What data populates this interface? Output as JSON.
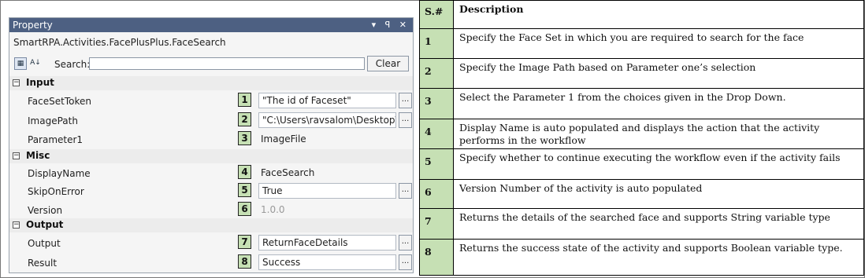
{
  "panel": {
    "title": "Property",
    "controls": "▾ ꟼ ✕",
    "subtitle": "SmartRPA.Activities.FacePlusPlus.FaceSearch",
    "search_label": "Search:",
    "search_value": "",
    "clear_label": "Clear",
    "categories": [
      {
        "name": "Input"
      },
      {
        "name": "Misc"
      },
      {
        "name": "Output"
      }
    ],
    "properties": [
      {
        "name": "FaceSetToken",
        "num": "1",
        "value": "\"The id of Faceset\""
      },
      {
        "name": "ImagePath",
        "num": "2",
        "value": "\"C:\\Users\\ravsalom\\Desktop\\ele"
      },
      {
        "name": "Parameter1",
        "num": "3",
        "value": "ImageFile"
      },
      {
        "name": "DisplayName",
        "num": "4",
        "value": "FaceSearch"
      },
      {
        "name": "SkipOnError",
        "num": "5",
        "value": "True"
      },
      {
        "name": "Version",
        "num": "6",
        "value": "1.0.0"
      },
      {
        "name": "Output",
        "num": "7",
        "value": "ReturnFaceDetails"
      },
      {
        "name": "Result",
        "num": "8",
        "value": "Success"
      }
    ],
    "ellipsis": "..."
  },
  "table": {
    "header": {
      "sn": "S.#",
      "desc": "Description"
    },
    "rows": [
      {
        "sn": "1",
        "desc": "Specify the Face Set in which you are required to search for the face"
      },
      {
        "sn": "2",
        "desc": "Specify the Image Path based on Parameter one’s selection"
      },
      {
        "sn": "3",
        "desc": "Select the Parameter 1 from the choices given in the Drop Down."
      },
      {
        "sn": "4",
        "desc": "Display Name is auto populated and displays the action that the activity performs in the workflow"
      },
      {
        "sn": "5",
        "desc": "Specify whether to continue executing the workflow even if the activity fails"
      },
      {
        "sn": "6",
        "desc": "Version Number of the activity is auto populated"
      },
      {
        "sn": "7",
        "desc": "Returns the details of the searched face and supports String variable type"
      },
      {
        "sn": "8",
        "desc": "Returns the success state of the activity and supports Boolean variable type."
      }
    ]
  },
  "colors": {
    "titlebar": "#4d6082",
    "number_badge": "#c6e0b4"
  }
}
